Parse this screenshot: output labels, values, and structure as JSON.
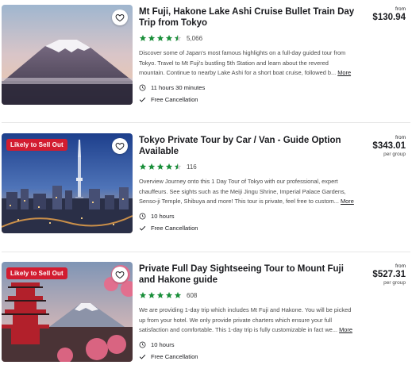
{
  "tours": [
    {
      "title": "Mt Fuji, Hakone Lake Ashi Cruise Bullet Train Day Trip from Tokyo",
      "badge": "",
      "rating": 4.5,
      "reviews": "5,066",
      "description": "Discover some of Japan's most famous highlights on a full-day guided tour from Tokyo. Travel to Mt Fuji's bustling 5th Station and learn about the revered mountain. Continue to nearby Lake Ashi for a short boat cruise, followed b...",
      "more_label": "More",
      "duration": "11 hours 30 minutes",
      "cancellation": "Free Cancellation",
      "price_from": "from",
      "price": "$130.94",
      "price_unit": "",
      "image": "mount-fuji-sunset-photo"
    },
    {
      "title": "Tokyo Private Tour by Car / Van - Guide Option Available",
      "badge": "Likely to Sell Out",
      "rating": 4.5,
      "reviews": "116",
      "description": "Overview Journey onto this 1 Day Tour of Tokyo with our professional, expert chauffeurs. See sights such as the Meiji Jingu Shrine, Imperial Palace Gardens, Senso-ji Temple, Shibuya and more! This tour is private, feel free to custom...",
      "more_label": "More",
      "duration": "10 hours",
      "cancellation": "Free Cancellation",
      "price_from": "from",
      "price": "$343.01",
      "price_unit": "per group",
      "image": "tokyo-skytree-city-photo"
    },
    {
      "title": "Private Full Day Sightseeing Tour to Mount Fuji and Hakone guide",
      "badge": "Likely to Sell Out",
      "rating": 5,
      "reviews": "608",
      "description": "We are providing 1-day trip which includes Mt Fuji and Hakone. You will be picked up from your hotel. We only provide private charters which ensure your full satisfaction and comfortable. This 1-day trip is fully customizable in fact we...",
      "more_label": "More",
      "duration": "10 hours",
      "cancellation": "Free Cancellation",
      "price_from": "from",
      "price": "$527.31",
      "price_unit": "per group",
      "image": "pagoda-fuji-photo"
    }
  ],
  "icons": {
    "wishlist": "heart-icon",
    "duration": "clock-icon",
    "cancellation": "checkmark-icon",
    "rating": "star-icon"
  },
  "colors": {
    "star": "#1a8f3a",
    "badge": "#d21c30",
    "text": "#1a1b1f",
    "muted": "#4a4a4a"
  }
}
